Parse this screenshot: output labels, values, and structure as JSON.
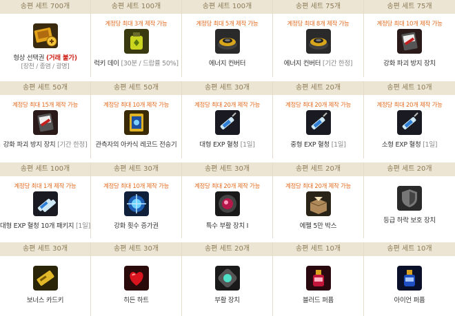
{
  "rows": [
    {
      "items": [
        {
          "cost": "송편 세트 700개",
          "limit": "",
          "name": "형상 선택권",
          "name_red": "(거래 불가)",
          "sub": "[장천 / 종염 / 광명]",
          "note": "",
          "icon": "ticket-icon"
        },
        {
          "cost": "송편 세트 100개",
          "limit": "계정당 최대 3개 제작 가능",
          "name": "럭키 데이",
          "name_red": "",
          "sub": "",
          "note": "[30분 / 드랍률 50%]",
          "icon": "lucky-potion-icon"
        },
        {
          "cost": "송편 세트 100개",
          "limit": "계정당 최대 5개 제작 가능",
          "name": "에너지 컨버터",
          "name_red": "",
          "sub": "",
          "note": "",
          "icon": "energy-converter-icon"
        },
        {
          "cost": "송편 세트 75개",
          "limit": "계정당 최대 8개 제작 가능",
          "name": "에너지 컨버터",
          "name_red": "",
          "sub": "",
          "note": "[기간 한정]",
          "icon": "energy-converter-icon"
        },
        {
          "cost": "송편 세트 75개",
          "limit": "계정당 최대 10개 제작 가능",
          "name": "강화 파괴 방지 장치",
          "name_red": "",
          "sub": "",
          "note": "",
          "icon": "protect-device-icon"
        }
      ]
    },
    {
      "items": [
        {
          "cost": "송편 세트 50개",
          "limit": "계정당 최대 15개 제작 가능",
          "name": "강화 파괴 방지 장치",
          "name_red": "",
          "sub": "",
          "note": "[기간 한정]",
          "icon": "protect-device-icon"
        },
        {
          "cost": "송편 세트 50개",
          "limit": "계정당 최대 10개 제작 가능",
          "name": "관측자의 아카식 레코드 전승기",
          "name_red": "",
          "sub": "",
          "note": "",
          "icon": "akashic-record-icon"
        },
        {
          "cost": "송편 세트 30개",
          "limit": "계정당 최대 20개 제작 가능",
          "name": "대형 EXP 혈청",
          "name_red": "",
          "sub": "",
          "note": "[1일]",
          "icon": "syringe-icon"
        },
        {
          "cost": "송편 세트 20개",
          "limit": "계정당 최대 20개 제작 가능",
          "name": "중형 EXP 혈청",
          "name_red": "",
          "sub": "",
          "note": "[1일]",
          "icon": "syringe-icon"
        },
        {
          "cost": "송편 세트 10개",
          "limit": "계정당 최대 20개 제작 가능",
          "name": "소형 EXP 혈청",
          "name_red": "",
          "sub": "",
          "note": "[1일]",
          "icon": "syringe-icon"
        }
      ]
    },
    {
      "items": [
        {
          "cost": "송편 세트 100개",
          "limit": "계정당 최대 1개 제작 가능",
          "name": "대형 EXP 혈청 10개 패키지",
          "name_red": "",
          "sub": "",
          "note": "[1일]",
          "icon": "syringe-pack-icon"
        },
        {
          "cost": "송편 세트 30개",
          "limit": "계정당 최대 10개 제작 가능",
          "name": "강화 횟수 증가권",
          "name_red": "",
          "sub": "",
          "note": "",
          "icon": "enhance-ticket-icon"
        },
        {
          "cost": "송편 세트 30개",
          "limit": "계정당 최대 20개 제작 가능",
          "name": "특수 부활 장치 I",
          "name_red": "",
          "sub": "",
          "note": "",
          "icon": "revival-device-icon"
        },
        {
          "cost": "송편 세트 20개",
          "limit": "계정당 최대 20개 제작 가능",
          "name": "에펠 5만 박스",
          "name_red": "",
          "sub": "",
          "note": "",
          "icon": "box-icon"
        },
        {
          "cost": "송편 세트 20개",
          "limit": "",
          "name": "등급 하락 보호 장치",
          "name_red": "",
          "sub": "",
          "note": "",
          "icon": "shield-icon"
        }
      ]
    },
    {
      "items": [
        {
          "cost": "송편 세트 30개",
          "limit": "",
          "name": "보너스 카드키",
          "name_red": "",
          "sub": "",
          "note": "",
          "icon": "cardkey-icon"
        },
        {
          "cost": "송편 세트 30개",
          "limit": "",
          "name": "히든 하트",
          "name_red": "",
          "sub": "",
          "note": "",
          "icon": "heart-icon"
        },
        {
          "cost": "송편 세트 20개",
          "limit": "",
          "name": "부활 장치",
          "name_red": "",
          "sub": "",
          "note": "",
          "icon": "revival-gem-icon"
        },
        {
          "cost": "송편 세트 10개",
          "limit": "",
          "name": "블러드 퍼퓸",
          "name_red": "",
          "sub": "",
          "note": "",
          "icon": "blood-perfume-icon"
        },
        {
          "cost": "송편 세트 10개",
          "limit": "",
          "name": "아이언 퍼퓸",
          "name_red": "",
          "sub": "",
          "note": "",
          "icon": "iron-perfume-icon"
        }
      ]
    }
  ],
  "colors": {
    "header_bg": "#ece5d3",
    "header_text": "#8b7a56",
    "limit_text": "#e46b1f",
    "red_text": "#d0281f"
  }
}
